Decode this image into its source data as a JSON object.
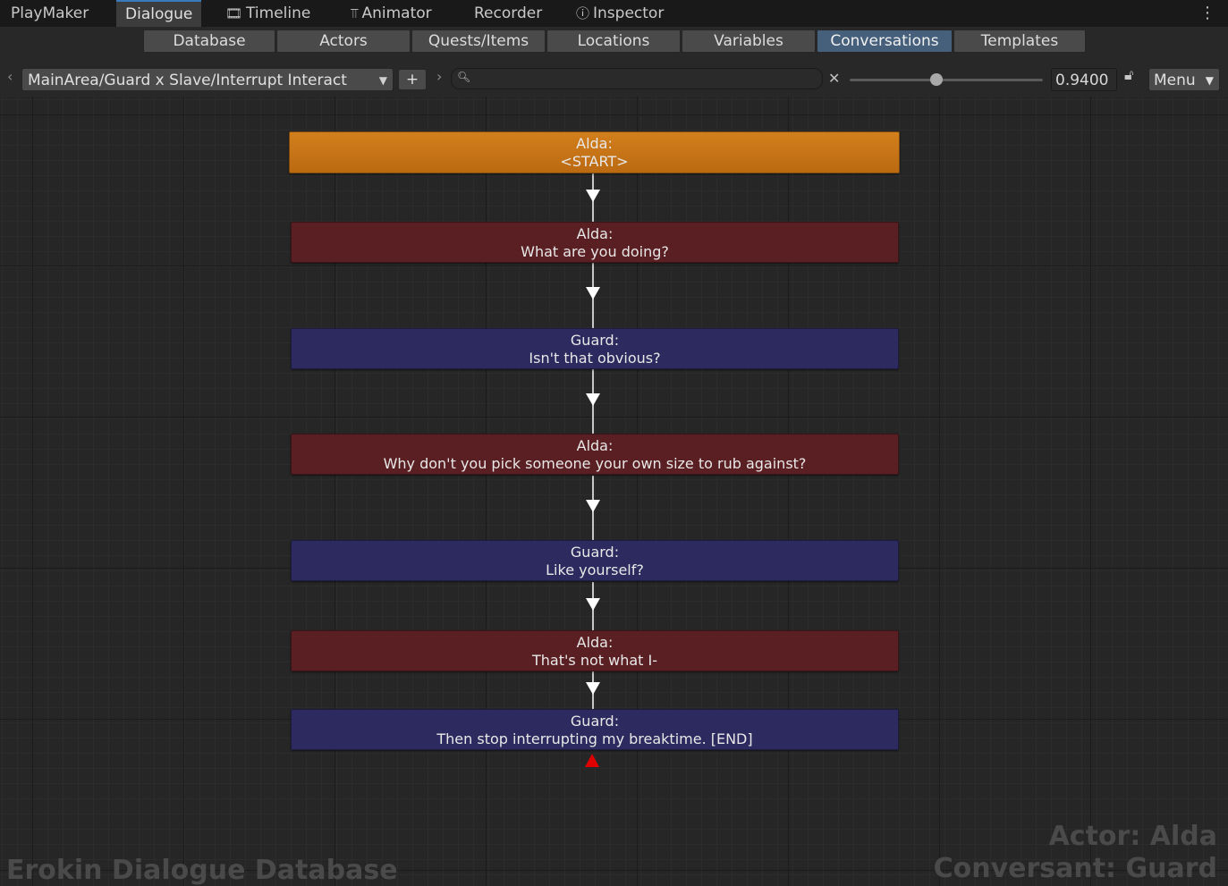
{
  "window_tabs": [
    {
      "label": "PlayMaker",
      "icon": ""
    },
    {
      "label": "Dialogue",
      "icon": "",
      "active": true
    },
    {
      "label": "Timeline",
      "icon": "film-icon"
    },
    {
      "label": "Animator",
      "icon": "animator-icon"
    },
    {
      "label": "Recorder",
      "icon": ""
    },
    {
      "label": "Inspector",
      "icon": "info-icon"
    }
  ],
  "section_tabs": [
    "Database",
    "Actors",
    "Quests/Items",
    "Locations",
    "Variables",
    "Conversations",
    "Templates"
  ],
  "active_section": "Conversations",
  "toolbar": {
    "conversation": "MainArea/Guard x Slave/Interrupt Interact",
    "add_label": "+",
    "search_value": "",
    "zoom_value": "0.9400",
    "zoom_fraction": 0.45,
    "menu_label": "Menu"
  },
  "nodes": [
    {
      "speaker": "Alda:",
      "text": "<START>",
      "type": "start"
    },
    {
      "speaker": "Alda:",
      "text": "What are you doing?",
      "type": "alda"
    },
    {
      "speaker": "Guard:",
      "text": "Isn't that obvious?",
      "type": "guard"
    },
    {
      "speaker": "Alda:",
      "text": "Why don't you pick someone your own size to rub against?",
      "type": "alda"
    },
    {
      "speaker": "Guard:",
      "text": "Like yourself?",
      "type": "guard"
    },
    {
      "speaker": "Alda:",
      "text": "That's not what I-",
      "type": "alda"
    },
    {
      "speaker": "Guard:",
      "text": "Then stop interrupting my breaktime. [END]",
      "type": "guard"
    }
  ],
  "watermarks": {
    "database": "Erokin Dialogue Database",
    "actor": "Actor: Alda",
    "conversant": "Conversant: Guard"
  },
  "colors": {
    "start_node": "#c8741a",
    "alda_node": "#5a1f22",
    "guard_node": "#2c2a5e",
    "active_tab": "#46607c",
    "end_marker": "#e00000"
  }
}
